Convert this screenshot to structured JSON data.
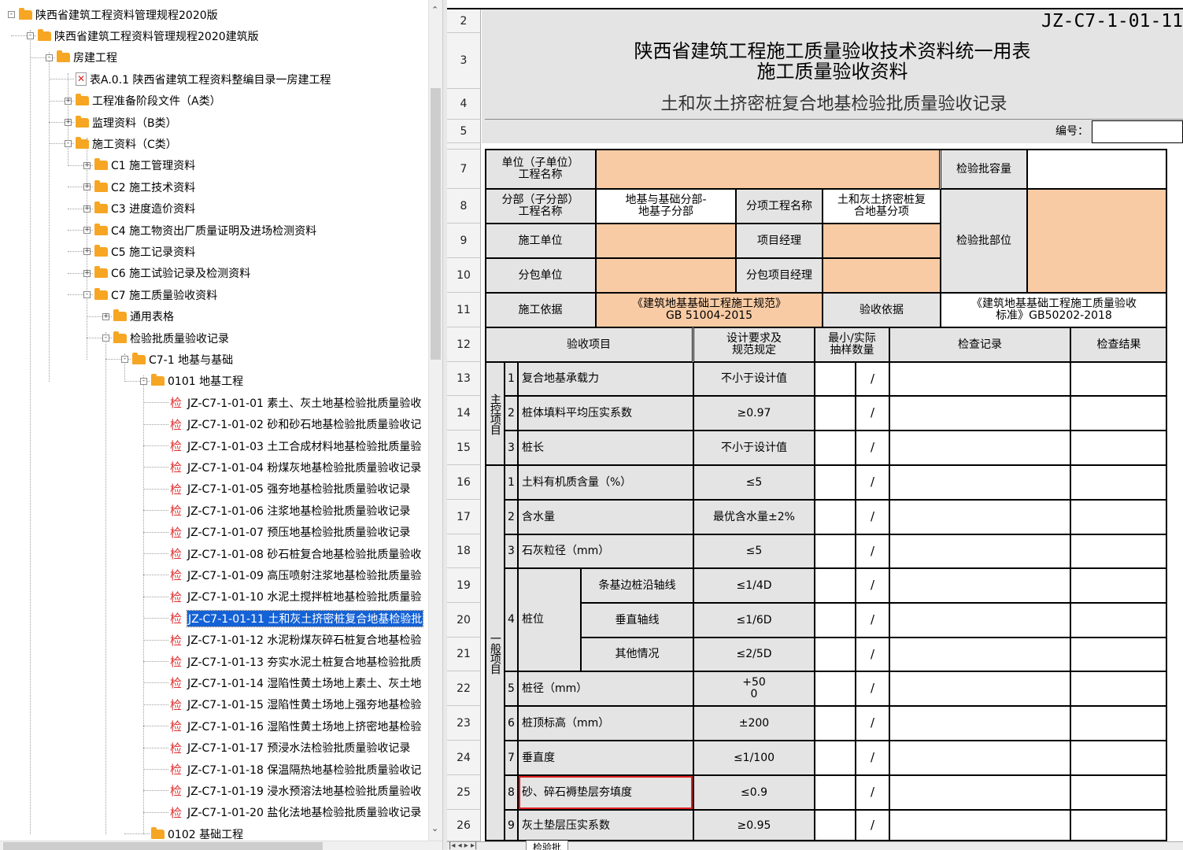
{
  "tree": {
    "items": [
      {
        "label": "陕西省建筑工程资料管理规程2020版",
        "type": "folder"
      },
      {
        "label": "陕西省建筑工程资料管理规程2020建筑版",
        "type": "folder"
      },
      {
        "label": "房建工程",
        "type": "folder"
      },
      {
        "label": "表A.0.1 陕西省建筑工程资料整编目录一房建工程",
        "type": "pdf"
      },
      {
        "label": "工程准备阶段文件（A类）",
        "type": "folder"
      },
      {
        "label": "监理资料（B类）",
        "type": "folder"
      },
      {
        "label": "施工资料（C类）",
        "type": "folder"
      },
      {
        "label": "C1 施工管理资料",
        "type": "folder"
      },
      {
        "label": "C2 施工技术资料",
        "type": "folder"
      },
      {
        "label": "C3 进度造价资料",
        "type": "folder"
      },
      {
        "label": "C4 施工物资出厂质量证明及进场检测资料",
        "type": "folder"
      },
      {
        "label": "C5 施工记录资料",
        "type": "folder"
      },
      {
        "label": "C6 施工试验记录及检测资料",
        "type": "folder"
      },
      {
        "label": "C7 施工质量验收资料",
        "type": "folder"
      },
      {
        "label": "通用表格",
        "type": "folder"
      },
      {
        "label": "检验批质量验收记录",
        "type": "folder"
      },
      {
        "label": "C7-1 地基与基础",
        "type": "folder"
      },
      {
        "label": "0101 地基工程",
        "type": "folder"
      },
      {
        "label": "JZ-C7-1-01-01 素土、灰土地基检验批质量验收",
        "type": "form"
      },
      {
        "label": "JZ-C7-1-01-02 砂和砂石地基检验批质量验收记",
        "type": "form"
      },
      {
        "label": "JZ-C7-1-01-03 土工合成材料地基检验批质量验",
        "type": "form"
      },
      {
        "label": "JZ-C7-1-01-04 粉煤灰地基检验批质量验收记录",
        "type": "form"
      },
      {
        "label": "JZ-C7-1-01-05 强夯地基检验批质量验收记录",
        "type": "form"
      },
      {
        "label": "JZ-C7-1-01-06 注浆地基检验批质量验收记录",
        "type": "form"
      },
      {
        "label": "JZ-C7-1-01-07 预压地基检验批质量验收记录",
        "type": "form"
      },
      {
        "label": "JZ-C7-1-01-08 砂石桩复合地基检验批质量验收",
        "type": "form"
      },
      {
        "label": "JZ-C7-1-01-09 高压喷射注浆地基检验批质量验",
        "type": "form"
      },
      {
        "label": "JZ-C7-1-01-10 水泥土搅拌桩地基检验批质量验",
        "type": "form"
      },
      {
        "label": "JZ-C7-1-01-11 土和灰土挤密桩复合地基检验批",
        "type": "form"
      },
      {
        "label": "JZ-C7-1-01-12 水泥粉煤灰碎石桩复合地基检验",
        "type": "form"
      },
      {
        "label": "JZ-C7-1-01-13 夯实水泥土桩复合地基检验批质",
        "type": "form"
      },
      {
        "label": "JZ-C7-1-01-14 湿陷性黄土场地上素土、灰土地",
        "type": "form"
      },
      {
        "label": "JZ-C7-1-01-15 湿陷性黄土场地上强夯地基检验",
        "type": "form"
      },
      {
        "label": "JZ-C7-1-01-16 湿陷性黄土场地上挤密地基检验",
        "type": "form"
      },
      {
        "label": "JZ-C7-1-01-17 预浸水法检验批质量验收记录",
        "type": "form"
      },
      {
        "label": "JZ-C7-1-01-18 保温隔热地基检验批质量验收记",
        "type": "form"
      },
      {
        "label": "JZ-C7-1-01-19 浸水预溶法地基检验批质量验收",
        "type": "form"
      },
      {
        "label": "JZ-C7-1-01-20 盐化法地基检验批质量验收记录",
        "type": "form"
      },
      {
        "label": "0102 基础工程",
        "type": "folder"
      }
    ],
    "form_icon_glyph": "检",
    "pdf_icon_glyph": "✕",
    "selected_index": 28
  },
  "sheet": {
    "row_numbers": [
      "2",
      "3",
      "4",
      "5",
      "7",
      "8",
      "9",
      "10",
      "11",
      "12",
      "13",
      "14",
      "15",
      "16",
      "17",
      "18",
      "19",
      "20",
      "21",
      "22",
      "23",
      "24",
      "25",
      "26"
    ],
    "form_code": "JZ-C7-1-01-11",
    "title_line1": "陕西省建筑工程施工质量验收技术资料统一用表",
    "title_line2": "施工质量验收资料",
    "subtitle": "土和灰土挤密桩复合地基检验批质量验收记录",
    "number_label": "编号：",
    "h": {
      "unit_name": "单位（子单位）\n工程名称",
      "batch_capacity": "检验批容量",
      "division_name": "分部（子分部）\n工程名称",
      "division_value": "地基与基础分部-\n地基子分部",
      "subitem_name_label": "分项工程名称",
      "subitem_value": "土和灰土挤密桩复\n合地基分项",
      "batch_location": "检验批部位",
      "construction_unit": "施工单位",
      "project_manager": "项目经理",
      "subcontract_unit": "分包单位",
      "subcontract_manager": "分包项目经理",
      "construction_basis": "施工依据",
      "construction_basis_value": "《建筑地基基础工程施工规范》\nGB 51004-2015",
      "acceptance_basis": "验收依据",
      "acceptance_basis_value": "《建筑地基基础工程施工质量验收\n标准》GB50202-2018",
      "col_item": "验收项目",
      "col_requirement": "设计要求及\n规范规定",
      "col_sampling": "最小/实际\n抽样数量",
      "col_record": "检查记录",
      "col_result": "检查结果"
    },
    "main_group_label": "主控项目",
    "general_group_label": "一般项目",
    "main_items": [
      {
        "no": "1",
        "name": "复合地基承载力",
        "req": "不小于设计值",
        "slash": "/"
      },
      {
        "no": "2",
        "name": "桩体填料平均压实系数",
        "req": "≥0.97",
        "slash": "/"
      },
      {
        "no": "3",
        "name": "桩长",
        "req": "不小于设计值",
        "slash": "/"
      }
    ],
    "general_items": [
      {
        "no": "1",
        "name": "土料有机质含量（%）",
        "req": "≤5",
        "slash": "/"
      },
      {
        "no": "2",
        "name": "含水量",
        "req": "最优含水量±2%",
        "slash": "/"
      },
      {
        "no": "3",
        "name": "石灰粒径（mm）",
        "req": "≤5",
        "slash": "/"
      },
      {
        "no": "4",
        "name": "桩位",
        "subs": [
          {
            "name": "条基边桩沿轴线",
            "req": "≤1/4D",
            "slash": "/"
          },
          {
            "name": "垂直轴线",
            "req": "≤1/6D",
            "slash": "/"
          },
          {
            "name": "其他情况",
            "req": "≤2/5D",
            "slash": "/"
          }
        ]
      },
      {
        "no": "5",
        "name": "桩径（mm）",
        "req": "+50\n0",
        "slash": "/"
      },
      {
        "no": "6",
        "name": "桩顶标高（mm）",
        "req": "±200",
        "slash": "/"
      },
      {
        "no": "7",
        "name": "垂直度",
        "req": "≤1/100",
        "slash": "/"
      },
      {
        "no": "8",
        "name": "砂、碎石褥垫层夯填度",
        "req": "≤0.9",
        "slash": "/"
      },
      {
        "no": "9",
        "name": "灰土垫层压实系数",
        "req": "≥0.95",
        "slash": "/"
      }
    ],
    "highlight_color": "#e02020",
    "tab_label": "检验批"
  }
}
